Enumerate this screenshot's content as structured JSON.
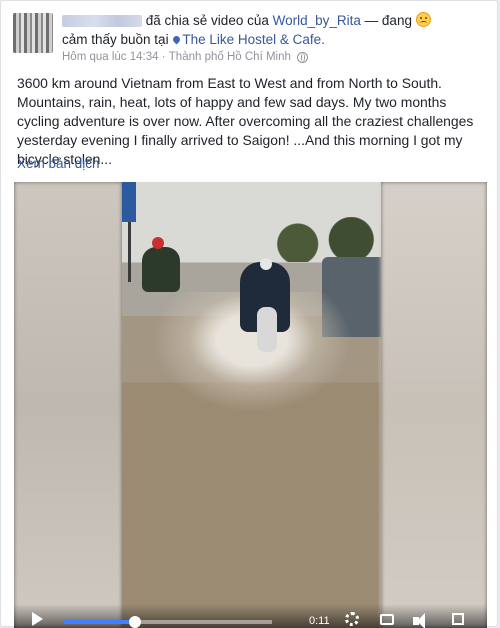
{
  "post": {
    "shared_text": "đã chia sẻ video của",
    "shared_page": "World_by_Rita",
    "feeling_prefix": " — đang",
    "feeling_text": "cảm thấy buồn tại",
    "location": "The Like Hostel & Cafe",
    "timestamp": "Hôm qua lúc 14:34",
    "city": "Thành phố Hồ Chí Minh",
    "body": "3600 km around Vietnam from East to West and from North to South. Mountains, rain, heat, lots of happy and few sad days. My two months cycling adventure is over now. After overcoming all the craziest challenges yesterday evening I finally arrived to Saigon! ...And this morning I got my bicycle stolen...",
    "translate_link": "Xem bản dịch"
  },
  "video": {
    "time": "0:11",
    "progress": 0.34,
    "icons": [
      "play-icon",
      "gear-icon",
      "hd-icon",
      "speaker-icon",
      "fullscreen-icon"
    ]
  },
  "colors": {
    "link": "#365899",
    "progress": "#4080ff"
  }
}
